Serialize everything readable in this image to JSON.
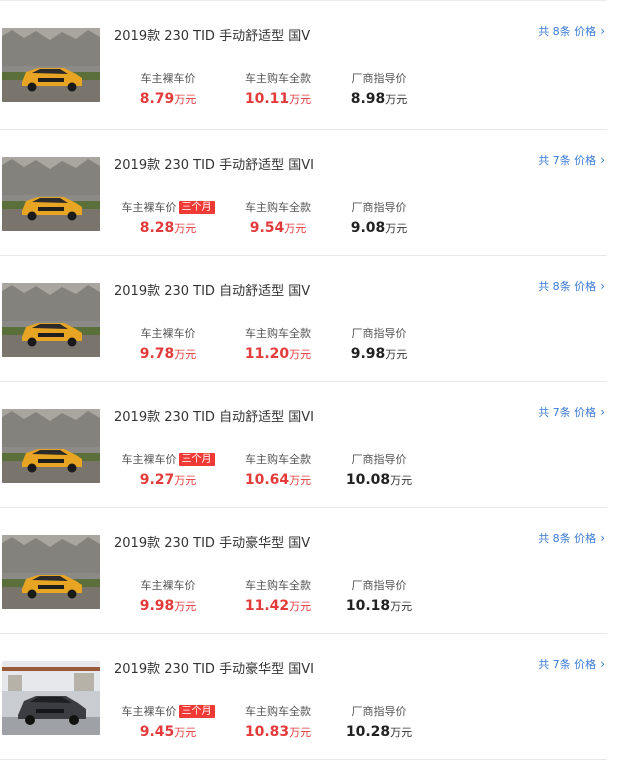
{
  "link_chevron": "›",
  "rows": [
    {
      "title": "2019款 230 TID 手动舒适型 国V",
      "price_link": "共 8条 价格",
      "owner_price": {
        "label": "车主裸车价",
        "value": "8.79",
        "unit": "万元",
        "badge": ""
      },
      "full_price": {
        "label": "车主购车全款",
        "value": "10.11",
        "unit": "万元"
      },
      "msrp": {
        "label": "厂商指导价",
        "value": "8.98",
        "unit": "万元"
      },
      "image": "yellow-suv-photo"
    },
    {
      "title": "2019款 230 TID 手动舒适型 国VI",
      "price_link": "共 7条 价格",
      "owner_price": {
        "label": "车主裸车价",
        "value": "8.28",
        "unit": "万元",
        "badge": "三个月"
      },
      "full_price": {
        "label": "车主购车全款",
        "value": "9.54",
        "unit": "万元"
      },
      "msrp": {
        "label": "厂商指导价",
        "value": "9.08",
        "unit": "万元"
      },
      "image": "yellow-suv-photo"
    },
    {
      "title": "2019款 230 TID 自动舒适型 国V",
      "price_link": "共 8条 价格",
      "owner_price": {
        "label": "车主裸车价",
        "value": "9.78",
        "unit": "万元",
        "badge": ""
      },
      "full_price": {
        "label": "车主购车全款",
        "value": "11.20",
        "unit": "万元"
      },
      "msrp": {
        "label": "厂商指导价",
        "value": "9.98",
        "unit": "万元"
      },
      "image": "yellow-suv-photo"
    },
    {
      "title": "2019款 230 TID 自动舒适型 国VI",
      "price_link": "共 7条 价格",
      "owner_price": {
        "label": "车主裸车价",
        "value": "9.27",
        "unit": "万元",
        "badge": "三个月"
      },
      "full_price": {
        "label": "车主购车全款",
        "value": "10.64",
        "unit": "万元"
      },
      "msrp": {
        "label": "厂商指导价",
        "value": "10.08",
        "unit": "万元"
      },
      "image": "yellow-suv-photo"
    },
    {
      "title": "2019款 230 TID 手动豪华型 国V",
      "price_link": "共 8条 价格",
      "owner_price": {
        "label": "车主裸车价",
        "value": "9.98",
        "unit": "万元",
        "badge": ""
      },
      "full_price": {
        "label": "车主购车全款",
        "value": "11.42",
        "unit": "万元"
      },
      "msrp": {
        "label": "厂商指导价",
        "value": "10.18",
        "unit": "万元"
      },
      "image": "yellow-suv-photo"
    },
    {
      "title": "2019款 230 TID 手动豪华型 国VI",
      "price_link": "共 7条 价格",
      "owner_price": {
        "label": "车主裸车价",
        "value": "9.45",
        "unit": "万元",
        "badge": "三个月"
      },
      "full_price": {
        "label": "车主购车全款",
        "value": "10.83",
        "unit": "万元"
      },
      "msrp": {
        "label": "厂商指导价",
        "value": "10.28",
        "unit": "万元"
      },
      "image": "gray-suv-photo"
    }
  ],
  "colors": {
    "price_red": "#e33b3b",
    "badge_red": "#ef3a36",
    "link_blue": "#3a7bd5",
    "car_yellow": "#e7a523",
    "car_gray": "#3b3d42"
  }
}
